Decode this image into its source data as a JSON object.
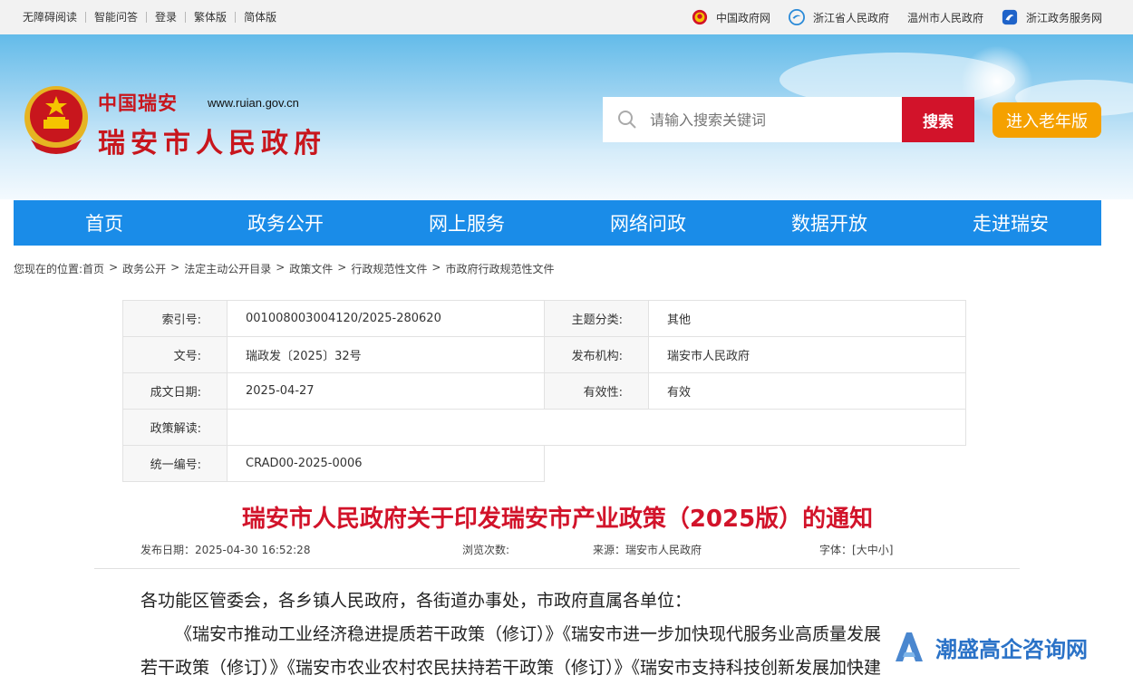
{
  "topbar": {
    "links": [
      "无障碍阅读",
      "智能问答",
      "登录",
      "繁体版",
      "简体版"
    ],
    "sites": [
      "中国政府网",
      "浙江省人民政府",
      "温州市人民政府",
      "浙江政务服务网"
    ]
  },
  "header": {
    "logo_top": "中国瑞安",
    "logo_url": "www.ruian.gov.cn",
    "logo_name": "瑞安市人民政府",
    "search_placeholder": "请输入搜索关键词",
    "search_button": "搜索",
    "elder_button": "进入老年版"
  },
  "nav": [
    "首页",
    "政务公开",
    "网上服务",
    "网络问政",
    "数据开放",
    "走进瑞安"
  ],
  "breadcrumb": {
    "prefix": "您现在的位置:",
    "items": [
      "首页",
      "政务公开",
      "法定主动公开目录",
      "政策文件",
      "行政规范性文件",
      "市政府行政规范性文件"
    ],
    "separator": ">"
  },
  "info": {
    "index_label": "索引号:",
    "index_value": "001008003004120/2025-280620",
    "topic_label": "主题分类:",
    "topic_value": "其他",
    "docno_label": "文号:",
    "docno_value": "瑞政发〔2025〕32号",
    "org_label": "发布机构:",
    "org_value": "瑞安市人民政府",
    "date_label": "成文日期:",
    "date_value": "2025-04-27",
    "valid_label": "有效性:",
    "valid_value": "有效",
    "interp_label": "政策解读:",
    "interp_value": "",
    "code_label": "统一编号:",
    "code_value": "CRAD00-2025-0006"
  },
  "article": {
    "title": "瑞安市人民政府关于印发瑞安市产业政策（2025版）的通知",
    "publish_time": "发布日期：2025-04-30 16:52:28",
    "views": "浏览次数:",
    "source": "来源：瑞安市人民政府",
    "font_label": "字体：[",
    "font_large": "大",
    "font_medium": "中",
    "font_small": "小",
    "font_close": "]",
    "line1": "各功能区管委会，各乡镇人民政府，各街道办事处，市政府直属各单位：",
    "line2": "《瑞安市推动工业经济稳进提质若干政策（修订）》《瑞安市进一步加快现代服务业高质量发展",
    "line3": "若干政策（修订）》《瑞安市农业农村农民扶持若干政策（修订）》《瑞安市支持科技创新发展加快建"
  },
  "watermark": {
    "text": "潮盛高企咨询网"
  },
  "colors": {
    "nav_blue": "#1a8ce8",
    "brand_red": "#d2132a",
    "elder_orange": "#f5a100"
  }
}
